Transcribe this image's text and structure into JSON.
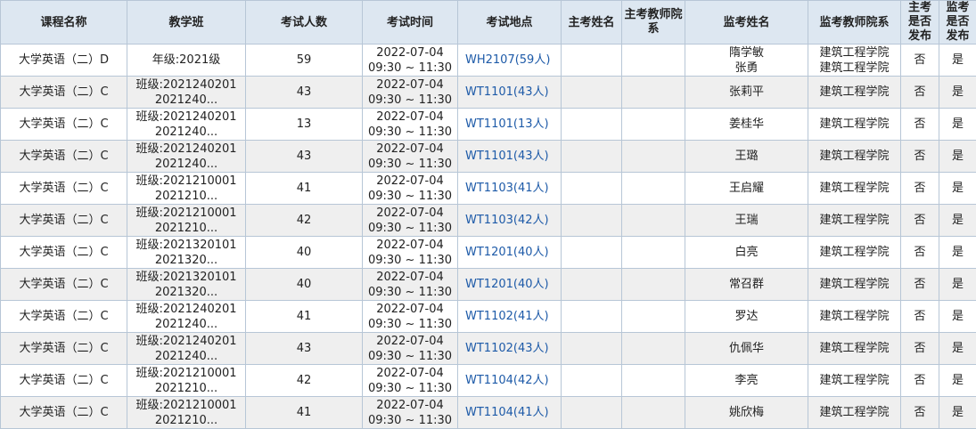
{
  "headers": [
    "课程名称",
    "教学班",
    "考试人数",
    "考试时间",
    "考试地点",
    "主考姓名",
    "主考教师院系",
    "监考姓名",
    "监考教师院系",
    "主考是否发布",
    "监考是否发布"
  ],
  "rows": [
    {
      "course": "大学英语（二）D",
      "class_lines": [
        "年级:2021级"
      ],
      "count": "59",
      "date": "2022-07-04",
      "time": "09:30 ~ 11:30",
      "location": "WH2107(59人)",
      "chief_name": "",
      "chief_dept": "",
      "proctor_lines": [
        "隋学敏",
        "张勇"
      ],
      "proctor_dept_lines": [
        "建筑工程学院",
        "建筑工程学院"
      ],
      "chief_pub": "否",
      "proctor_pub": "是"
    },
    {
      "course": "大学英语（二）C",
      "class_lines": [
        "班级:2021240201",
        "2021240..."
      ],
      "count": "43",
      "date": "2022-07-04",
      "time": "09:30 ~ 11:30",
      "location": "WT1101(43人)",
      "chief_name": "",
      "chief_dept": "",
      "proctor_lines": [
        "张莉平"
      ],
      "proctor_dept_lines": [
        "建筑工程学院"
      ],
      "chief_pub": "否",
      "proctor_pub": "是"
    },
    {
      "course": "大学英语（二）C",
      "class_lines": [
        "班级:2021240201",
        "2021240..."
      ],
      "count": "13",
      "date": "2022-07-04",
      "time": "09:30 ~ 11:30",
      "location": "WT1101(13人)",
      "chief_name": "",
      "chief_dept": "",
      "proctor_lines": [
        "姜桂华"
      ],
      "proctor_dept_lines": [
        "建筑工程学院"
      ],
      "chief_pub": "否",
      "proctor_pub": "是"
    },
    {
      "course": "大学英语（二）C",
      "class_lines": [
        "班级:2021240201",
        "2021240..."
      ],
      "count": "43",
      "date": "2022-07-04",
      "time": "09:30 ~ 11:30",
      "location": "WT1101(43人)",
      "chief_name": "",
      "chief_dept": "",
      "proctor_lines": [
        "王璐"
      ],
      "proctor_dept_lines": [
        "建筑工程学院"
      ],
      "chief_pub": "否",
      "proctor_pub": "是"
    },
    {
      "course": "大学英语（二）C",
      "class_lines": [
        "班级:2021210001",
        "2021210..."
      ],
      "count": "41",
      "date": "2022-07-04",
      "time": "09:30 ~ 11:30",
      "location": "WT1103(41人)",
      "chief_name": "",
      "chief_dept": "",
      "proctor_lines": [
        "王启耀"
      ],
      "proctor_dept_lines": [
        "建筑工程学院"
      ],
      "chief_pub": "否",
      "proctor_pub": "是"
    },
    {
      "course": "大学英语（二）C",
      "class_lines": [
        "班级:2021210001",
        "2021210..."
      ],
      "count": "42",
      "date": "2022-07-04",
      "time": "09:30 ~ 11:30",
      "location": "WT1103(42人)",
      "chief_name": "",
      "chief_dept": "",
      "proctor_lines": [
        "王瑞"
      ],
      "proctor_dept_lines": [
        "建筑工程学院"
      ],
      "chief_pub": "否",
      "proctor_pub": "是"
    },
    {
      "course": "大学英语（二）C",
      "class_lines": [
        "班级:2021320101",
        "2021320..."
      ],
      "count": "40",
      "date": "2022-07-04",
      "time": "09:30 ~ 11:30",
      "location": "WT1201(40人)",
      "chief_name": "",
      "chief_dept": "",
      "proctor_lines": [
        "白亮"
      ],
      "proctor_dept_lines": [
        "建筑工程学院"
      ],
      "chief_pub": "否",
      "proctor_pub": "是"
    },
    {
      "course": "大学英语（二）C",
      "class_lines": [
        "班级:2021320101",
        "2021320..."
      ],
      "count": "40",
      "date": "2022-07-04",
      "time": "09:30 ~ 11:30",
      "location": "WT1201(40人)",
      "chief_name": "",
      "chief_dept": "",
      "proctor_lines": [
        "常召群"
      ],
      "proctor_dept_lines": [
        "建筑工程学院"
      ],
      "chief_pub": "否",
      "proctor_pub": "是"
    },
    {
      "course": "大学英语（二）C",
      "class_lines": [
        "班级:2021240201",
        "2021240..."
      ],
      "count": "41",
      "date": "2022-07-04",
      "time": "09:30 ~ 11:30",
      "location": "WT1102(41人)",
      "chief_name": "",
      "chief_dept": "",
      "proctor_lines": [
        "罗达"
      ],
      "proctor_dept_lines": [
        "建筑工程学院"
      ],
      "chief_pub": "否",
      "proctor_pub": "是"
    },
    {
      "course": "大学英语（二）C",
      "class_lines": [
        "班级:2021240201",
        "2021240..."
      ],
      "count": "43",
      "date": "2022-07-04",
      "time": "09:30 ~ 11:30",
      "location": "WT1102(43人)",
      "chief_name": "",
      "chief_dept": "",
      "proctor_lines": [
        "仇佩华"
      ],
      "proctor_dept_lines": [
        "建筑工程学院"
      ],
      "chief_pub": "否",
      "proctor_pub": "是"
    },
    {
      "course": "大学英语（二）C",
      "class_lines": [
        "班级:2021210001",
        "2021210..."
      ],
      "count": "42",
      "date": "2022-07-04",
      "time": "09:30 ~ 11:30",
      "location": "WT1104(42人)",
      "chief_name": "",
      "chief_dept": "",
      "proctor_lines": [
        "李亮"
      ],
      "proctor_dept_lines": [
        "建筑工程学院"
      ],
      "chief_pub": "否",
      "proctor_pub": "是"
    },
    {
      "course": "大学英语（二）C",
      "class_lines": [
        "班级:2021210001",
        "2021210..."
      ],
      "count": "41",
      "date": "2022-07-04",
      "time": "09:30 ~ 11:30",
      "location": "WT1104(41人)",
      "chief_name": "",
      "chief_dept": "",
      "proctor_lines": [
        "姚欣梅"
      ],
      "proctor_dept_lines": [
        "建筑工程学院"
      ],
      "chief_pub": "否",
      "proctor_pub": "是"
    }
  ]
}
